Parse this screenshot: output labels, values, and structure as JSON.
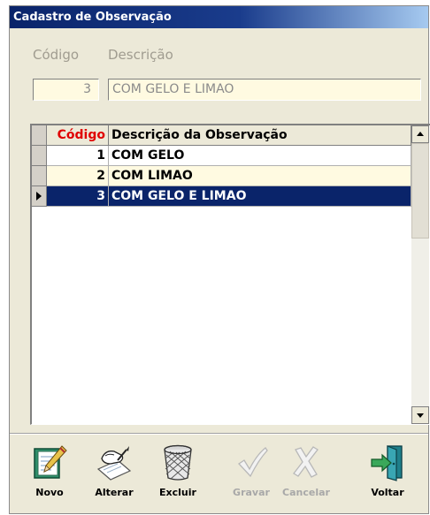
{
  "window": {
    "title": "Cadastro de Observação"
  },
  "form": {
    "codigo_label": "Código",
    "descricao_label": "Descrição",
    "codigo_value": "3",
    "descricao_value": "COM GELO E LIMAO"
  },
  "grid": {
    "headers": {
      "codigo": "Código",
      "descricao": "Descrição da Observação"
    },
    "rows": [
      {
        "codigo": "1",
        "descricao": "COM GELO"
      },
      {
        "codigo": "2",
        "descricao": "COM LIMAO"
      },
      {
        "codigo": "3",
        "descricao": "COM GELO E LIMAO"
      }
    ],
    "selected_row": 3
  },
  "toolbar": {
    "novo": "Novo",
    "alterar": "Alterar",
    "excluir": "Excluir",
    "gravar": "Gravar",
    "cancelar": "Cancelar",
    "voltar": "Voltar"
  },
  "colors": {
    "title_bar": "#0a246a",
    "selection": "#0a246a",
    "field_background": "#fffae1",
    "header_codigo": "#e00000",
    "window_background": "#ece9d8"
  },
  "icons": {
    "novo": "notepad-pencil-icon",
    "alterar": "hand-writing-icon",
    "excluir": "wastebasket-icon",
    "gravar": "checkmark-icon",
    "cancelar": "x-mark-icon",
    "voltar": "exit-door-icon"
  }
}
